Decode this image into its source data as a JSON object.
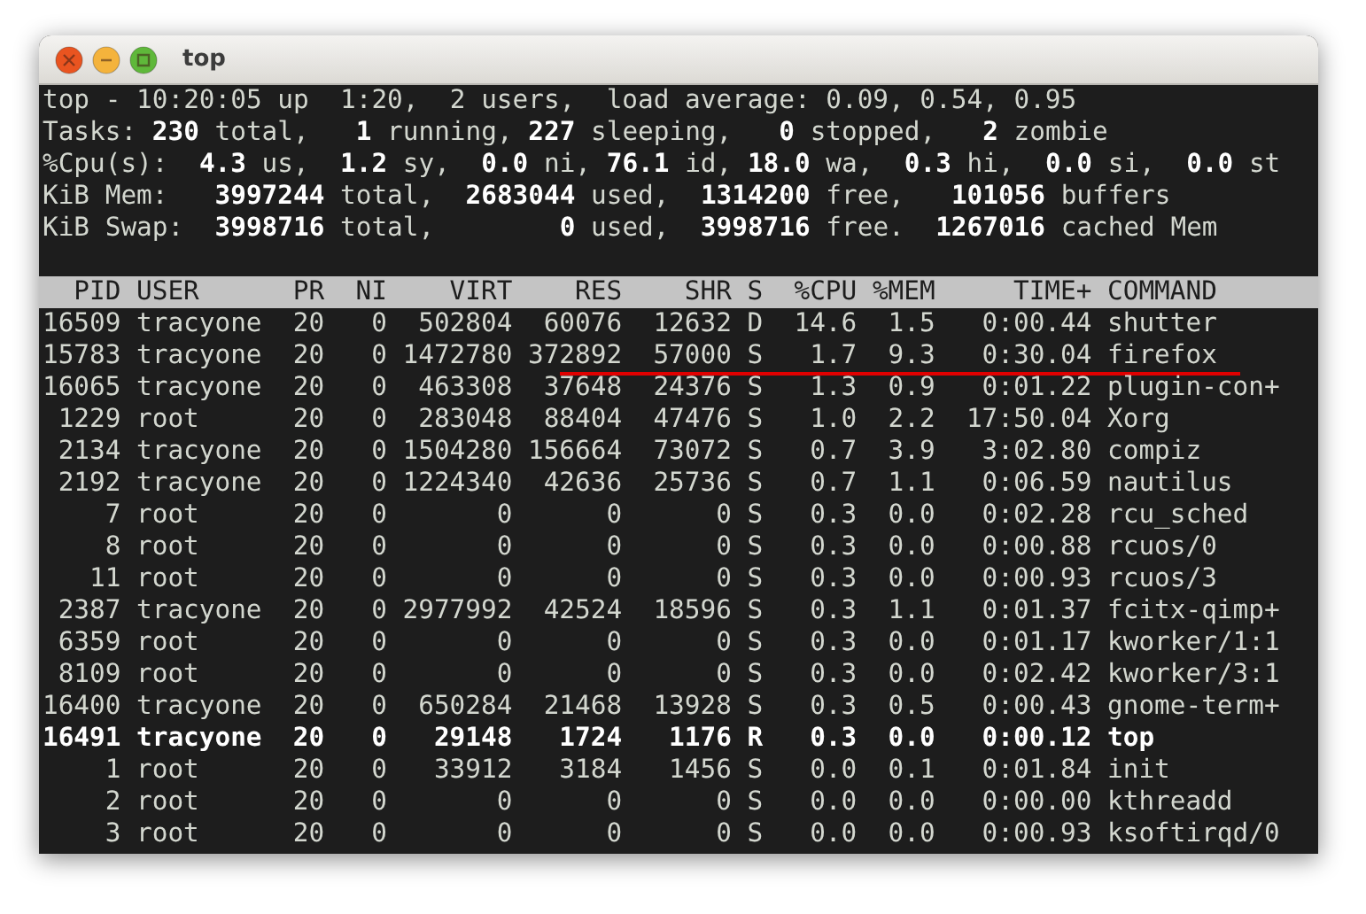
{
  "window": {
    "title": "top",
    "buttons": [
      {
        "kind": "close",
        "color": "#e95420"
      },
      {
        "kind": "minimize",
        "color": "#f4b33c"
      },
      {
        "kind": "maximize",
        "color": "#5fb83a"
      }
    ]
  },
  "summary": [
    "top - 10:20:05 up  1:20,  2 users,  load average: 0.09, 0.54, 0.95",
    "Tasks: **230** total,   **1** running, **227** sleeping,   **0** stopped,   **2** zombie",
    "%Cpu(s):  **4.3** us,  **1.2** sy,  **0.0** ni, **76.1** id, **18.0** wa,  **0.3** hi,  **0.0** si,  **0.0** st",
    "KiB Mem:   **3997244** total,  **2683044** used,  **1314200** free,   **101056** buffers",
    "KiB Swap:  **3998716** total,        **0** used,  **3998716** free.  **1267016** cached Mem"
  ],
  "table": {
    "columns": [
      "PID",
      "USER",
      "PR",
      "NI",
      "VIRT",
      "RES",
      "SHR",
      "S",
      "%CPU",
      "%MEM",
      "TIME+",
      "COMMAND"
    ],
    "rows": [
      {
        "cells": [
          "16509",
          "tracyone",
          "20",
          "0",
          "502804",
          "60076",
          "12632",
          "D",
          "14.6",
          "1.5",
          "0:00.44",
          "shutter"
        ],
        "highlighted": false,
        "underlined": false
      },
      {
        "cells": [
          "15783",
          "tracyone",
          "20",
          "0",
          "1472780",
          "372892",
          "57000",
          "S",
          "1.7",
          "9.3",
          "0:30.04",
          "firefox"
        ],
        "highlighted": false,
        "underlined": true
      },
      {
        "cells": [
          "16065",
          "tracyone",
          "20",
          "0",
          "463308",
          "37648",
          "24376",
          "S",
          "1.3",
          "0.9",
          "0:01.22",
          "plugin-con+"
        ],
        "highlighted": false,
        "underlined": false
      },
      {
        "cells": [
          "1229",
          "root",
          "20",
          "0",
          "283048",
          "88404",
          "47476",
          "S",
          "1.0",
          "2.2",
          "17:50.04",
          "Xorg"
        ],
        "highlighted": false,
        "underlined": false
      },
      {
        "cells": [
          "2134",
          "tracyone",
          "20",
          "0",
          "1504280",
          "156664",
          "73072",
          "S",
          "0.7",
          "3.9",
          "3:02.80",
          "compiz"
        ],
        "highlighted": false,
        "underlined": false
      },
      {
        "cells": [
          "2192",
          "tracyone",
          "20",
          "0",
          "1224340",
          "42636",
          "25736",
          "S",
          "0.7",
          "1.1",
          "0:06.59",
          "nautilus"
        ],
        "highlighted": false,
        "underlined": false
      },
      {
        "cells": [
          "7",
          "root",
          "20",
          "0",
          "0",
          "0",
          "0",
          "S",
          "0.3",
          "0.0",
          "0:02.28",
          "rcu_sched"
        ],
        "highlighted": false,
        "underlined": false
      },
      {
        "cells": [
          "8",
          "root",
          "20",
          "0",
          "0",
          "0",
          "0",
          "S",
          "0.3",
          "0.0",
          "0:00.88",
          "rcuos/0"
        ],
        "highlighted": false,
        "underlined": false
      },
      {
        "cells": [
          "11",
          "root",
          "20",
          "0",
          "0",
          "0",
          "0",
          "S",
          "0.3",
          "0.0",
          "0:00.93",
          "rcuos/3"
        ],
        "highlighted": false,
        "underlined": false
      },
      {
        "cells": [
          "2387",
          "tracyone",
          "20",
          "0",
          "2977992",
          "42524",
          "18596",
          "S",
          "0.3",
          "1.1",
          "0:01.37",
          "fcitx-qimp+"
        ],
        "highlighted": false,
        "underlined": false
      },
      {
        "cells": [
          "6359",
          "root",
          "20",
          "0",
          "0",
          "0",
          "0",
          "S",
          "0.3",
          "0.0",
          "0:01.17",
          "kworker/1:1"
        ],
        "highlighted": false,
        "underlined": false
      },
      {
        "cells": [
          "8109",
          "root",
          "20",
          "0",
          "0",
          "0",
          "0",
          "S",
          "0.3",
          "0.0",
          "0:02.42",
          "kworker/3:1"
        ],
        "highlighted": false,
        "underlined": false
      },
      {
        "cells": [
          "16400",
          "tracyone",
          "20",
          "0",
          "650284",
          "21468",
          "13928",
          "S",
          "0.3",
          "0.5",
          "0:00.43",
          "gnome-term+"
        ],
        "highlighted": false,
        "underlined": false
      },
      {
        "cells": [
          "16491",
          "tracyone",
          "20",
          "0",
          "29148",
          "1724",
          "1176",
          "R",
          "0.3",
          "0.0",
          "0:00.12",
          "top"
        ],
        "highlighted": true,
        "underlined": false
      },
      {
        "cells": [
          "1",
          "root",
          "20",
          "0",
          "33912",
          "3184",
          "1456",
          "S",
          "0.0",
          "0.1",
          "0:01.84",
          "init"
        ],
        "highlighted": false,
        "underlined": false
      },
      {
        "cells": [
          "2",
          "root",
          "20",
          "0",
          "0",
          "0",
          "0",
          "S",
          "0.0",
          "0.0",
          "0:00.00",
          "kthreadd"
        ],
        "highlighted": false,
        "underlined": false
      },
      {
        "cells": [
          "3",
          "root",
          "20",
          "0",
          "0",
          "0",
          "0",
          "S",
          "0.0",
          "0.0",
          "0:00.93",
          "ksoftirqd/0"
        ],
        "highlighted": false,
        "underlined": false
      }
    ]
  }
}
